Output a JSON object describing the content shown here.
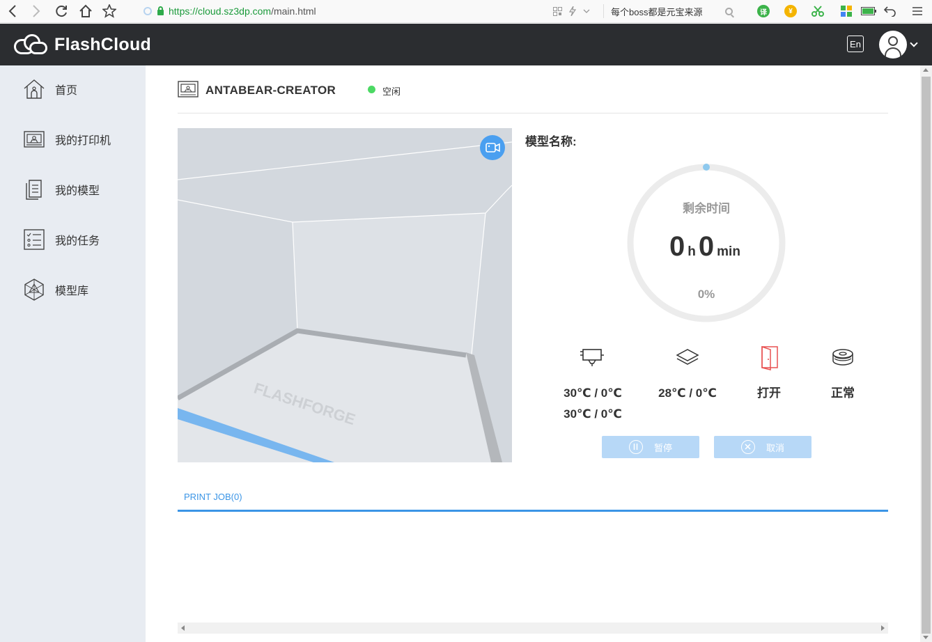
{
  "browser": {
    "url_prefix": "https://cloud.",
    "url_domain": "sz3dp.com",
    "url_path": "/main.html",
    "search_text": "每个boss都是元宝来源"
  },
  "app": {
    "logo_text": "FlashCloud",
    "lang_label": "En"
  },
  "sidebar": {
    "items": [
      {
        "label": "首页",
        "icon": "home-icon"
      },
      {
        "label": "我的打印机",
        "icon": "printer-icon"
      },
      {
        "label": "我的模型",
        "icon": "document-icon"
      },
      {
        "label": "我的任务",
        "icon": "tasklist-icon"
      },
      {
        "label": "模型库",
        "icon": "polyhedron-icon"
      }
    ]
  },
  "printer": {
    "name": "ANTABEAR-CREATOR",
    "status": "空闲",
    "status_color": "#4cd964"
  },
  "camera": {
    "watermark": "FLASHFORGE"
  },
  "job": {
    "model_label": "模型名称:",
    "remaining_label": "剩余时间",
    "hours": "0",
    "hours_unit": "h",
    "minutes": "0",
    "minutes_unit": "min",
    "progress_text": "0%",
    "progress": 0
  },
  "stats": {
    "nozzle_temp_1": "30℃ / 0℃",
    "nozzle_temp_2": "30℃ / 0℃",
    "bed_temp": "28℃ / 0℃",
    "door": "打开",
    "filament": "正常"
  },
  "actions": {
    "pause": "暂停",
    "cancel": "取消"
  },
  "tabs": {
    "print_job": "PRINT JOB(0)"
  },
  "colors": {
    "accent": "#3b95e6",
    "header_bg": "#2b2d30",
    "sidebar_bg": "#e8ecf2",
    "door_icon": "#e85050"
  }
}
